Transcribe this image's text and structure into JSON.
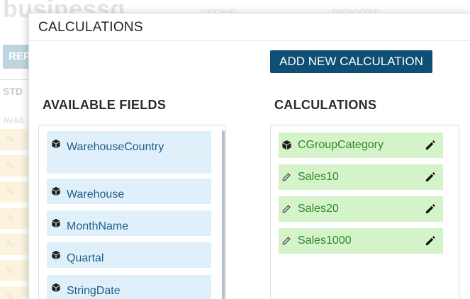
{
  "background": {
    "logo": "businessq",
    "menu_items": [
      "DEFINE",
      "REPORTS"
    ],
    "button_label": "REP",
    "tab_label": "STD",
    "section_label": "AVAIL"
  },
  "modal": {
    "title": "CALCULATIONS",
    "add_button_label": "ADD NEW CALCULATION"
  },
  "available_fields": {
    "title": "AVAILABLE FIELDS",
    "items": [
      {
        "label": "WarehouseCountry",
        "icon": "cube-icon"
      },
      {
        "label": "Warehouse",
        "icon": "cube-icon"
      },
      {
        "label": "MonthName",
        "icon": "cube-icon"
      },
      {
        "label": "Quartal",
        "icon": "cube-icon"
      },
      {
        "label": "StringDate",
        "icon": "cube-icon"
      }
    ]
  },
  "calculations": {
    "title": "CALCULATIONS",
    "items": [
      {
        "label": "CGroupCategory",
        "icon": "cube-icon"
      },
      {
        "label": "Sales10",
        "icon": "pencil-icon"
      },
      {
        "label": "Sales20",
        "icon": "pencil-icon"
      },
      {
        "label": "Sales1000",
        "icon": "pencil-icon"
      }
    ]
  },
  "colors": {
    "primary_button": "#0f4f73",
    "field_bg": "#e0f0fa",
    "field_text": "#1f5f8a",
    "calc_bg": "#d4f3c9",
    "calc_text": "#2d8a2d"
  }
}
